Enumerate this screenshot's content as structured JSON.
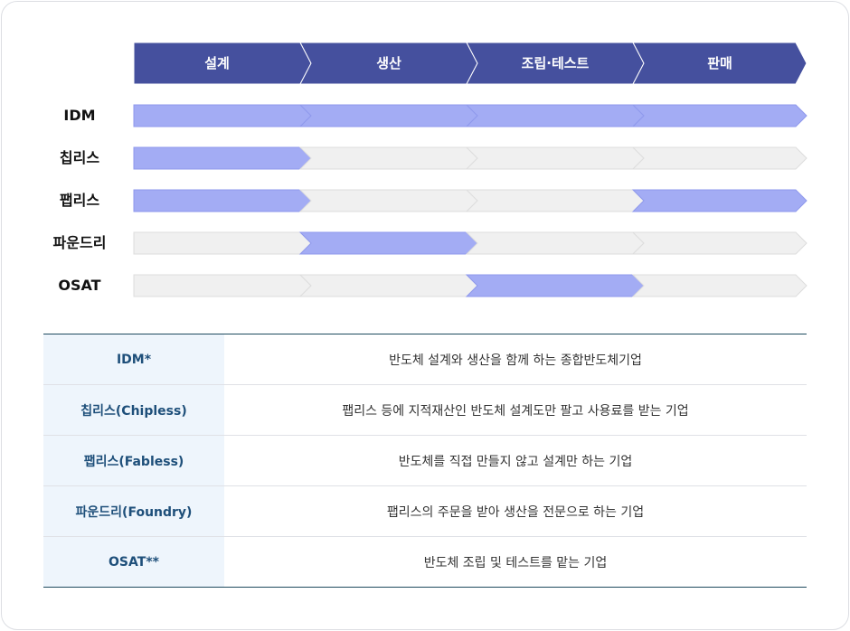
{
  "stages": [
    "설계",
    "생산",
    "조립·테스트",
    "판매"
  ],
  "rows": [
    {
      "label": "IDM",
      "active": [
        true,
        true,
        true,
        true
      ]
    },
    {
      "label": "칩리스",
      "active": [
        true,
        false,
        false,
        false
      ]
    },
    {
      "label": "팹리스",
      "active": [
        true,
        false,
        false,
        true
      ]
    },
    {
      "label": "파운드리",
      "active": [
        false,
        true,
        false,
        false
      ]
    },
    {
      "label": "OSAT",
      "active": [
        false,
        false,
        true,
        false
      ]
    }
  ],
  "colors": {
    "header": "#45509e",
    "active": "#a3acf4",
    "inactive": "#f0f0f0",
    "term_text": "#1e4f7a",
    "term_bg": "#eef5fc"
  },
  "definitions": [
    {
      "term": "IDM*",
      "description": "반도체 설계와 생산을 함께 하는 종합반도체기업"
    },
    {
      "term": "칩리스(Chipless)",
      "description": "팹리스 등에 지적재산인 반도체 설계도만 팔고 사용료를 받는 기업"
    },
    {
      "term": "팹리스(Fabless)",
      "description": "반도체를 직접 만들지 않고 설계만 하는 기업"
    },
    {
      "term": "파운드리(Foundry)",
      "description": "팹리스의 주문을 받아 생산을 전문으로 하는 기업"
    },
    {
      "term": "OSAT**",
      "description": "반도체 조립 및 테스트를 맡는 기업"
    }
  ]
}
